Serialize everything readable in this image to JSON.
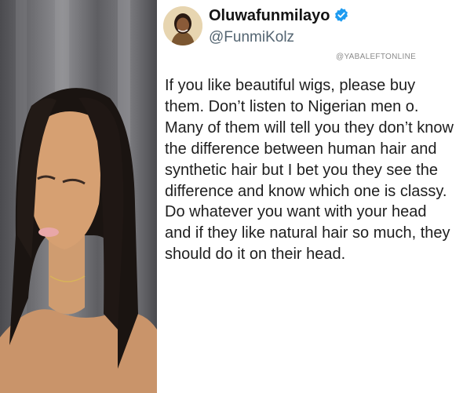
{
  "tweet": {
    "display_name": "Oluwafunmilayo",
    "handle": "@FunmiKolz",
    "verified_icon": "verified-badge-icon",
    "watermark": "@YABALEFTONLINE",
    "text_paragraph_1": "If you like beautiful wigs, please buy them. Don’t listen to Nigerian men o. Many of them will tell you they don’t know the difference between human hair and synthetic hair but I bet you they see the difference and know which one is classy.",
    "text_paragraph_2": "Do whatever you want with your head and if they like natural hair so much, they should do it on their head."
  },
  "colors": {
    "verified_blue": "#1d9bf0",
    "handle_gray": "#536471",
    "text": "#1e1e1e"
  }
}
